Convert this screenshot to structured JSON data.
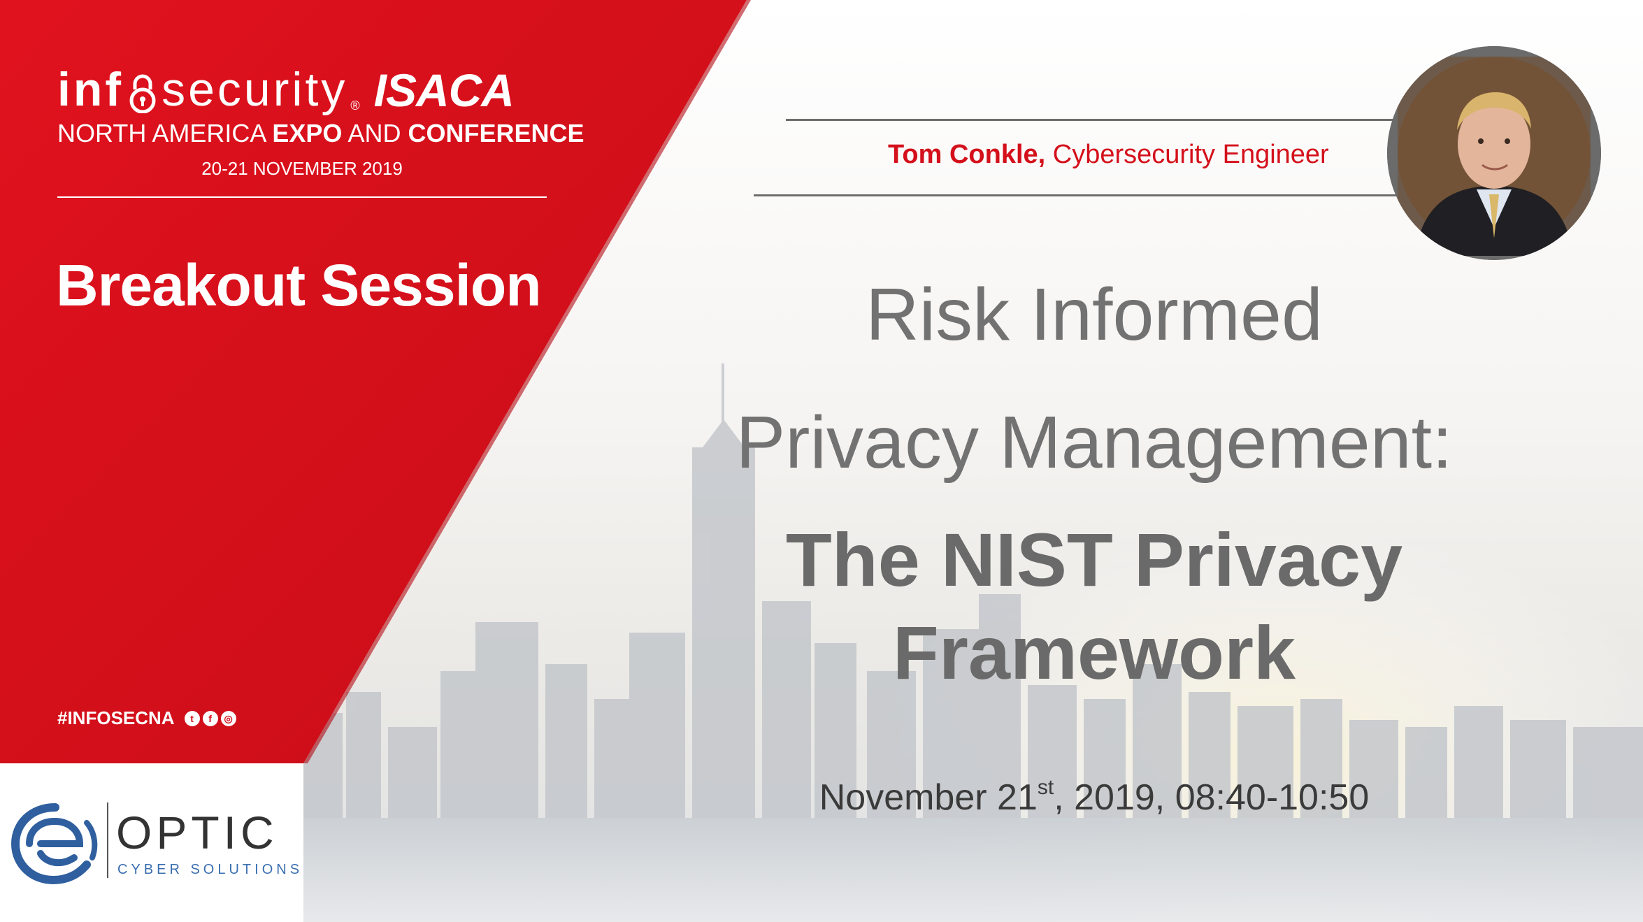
{
  "brand": {
    "info": "inf",
    "security": "security",
    "registered": "®",
    "isaca": "ISACA",
    "sub_plain_1": "NORTH AMERICA ",
    "sub_bold_1": "EXPO",
    "sub_plain_2": " AND ",
    "sub_bold_2": "CONFERENCE",
    "dates": "20-21 NOVEMBER 2019"
  },
  "session_type": "Breakout Session",
  "hashtag": "#INFOSECNA",
  "social_icons": [
    "twitter-icon",
    "facebook-icon",
    "instagram-icon"
  ],
  "sponsor": {
    "name": "OPTIC",
    "tagline": "CYBER SOLUTIONS"
  },
  "speaker": {
    "name": "Tom Conkle,",
    "role": " Cybersecurity Engineer"
  },
  "title": {
    "line1": "Risk Informed",
    "line2": "Privacy Management:",
    "line3": "The NIST Privacy",
    "line4": "Framework"
  },
  "session_date": {
    "prefix": "November 21",
    "suffix_sup": "st",
    "rest": ", 2019, 08:40-10:50"
  },
  "colors": {
    "brand_red": "#d4101b",
    "title_gray": "#727272",
    "optic_blue": "#3a6fb0"
  }
}
